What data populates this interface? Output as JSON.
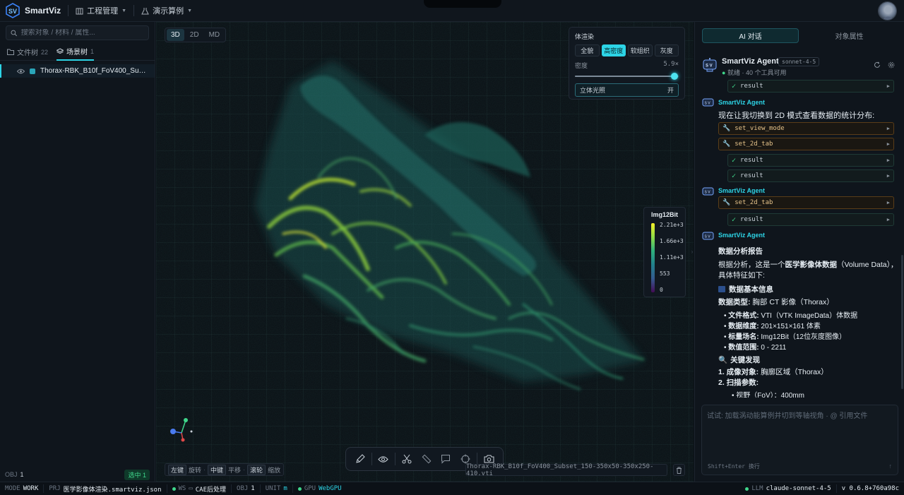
{
  "app": {
    "name": "SmartViz"
  },
  "topbar": {
    "menu_project": "工程管理",
    "menu_examples": "演示算例"
  },
  "left": {
    "search_placeholder": "搜索对象 / 材料 / 属性...",
    "tabs": [
      {
        "label": "文件树",
        "count": "22"
      },
      {
        "label": "场景树",
        "count": "1"
      }
    ],
    "tree_item": "Thorax-RBK_B10f_FoV400_Subs...",
    "footer_obj_label": "OBJ",
    "footer_obj_value": "1",
    "footer_selected": "选中 1"
  },
  "viewport": {
    "view_modes": [
      "3D",
      "2D",
      "MD"
    ],
    "active_view_mode": "3D",
    "volume_panel": {
      "title": "体渲染",
      "presets": [
        "全貌",
        "高密度",
        "软组织",
        "灰度"
      ],
      "active_preset": "高密度",
      "density_label": "密度",
      "density_value": "5.9×",
      "density_fraction": 0.96,
      "lighting_label": "立体光照",
      "lighting_state": "开"
    },
    "colorbar": {
      "title": "Img12Bit",
      "ticks": [
        "2.21e+3",
        "1.66e+3",
        "1.11e+3",
        "553",
        "0"
      ]
    },
    "hints": [
      {
        "key": "左键",
        "action": "旋转"
      },
      {
        "key": "中键",
        "action": "平移"
      },
      {
        "key": "滚轮",
        "action": "缩放"
      }
    ],
    "file_label": "Thorax-RBK_B10f_FoV400_Subset_150-350x50-350x250-410.vti"
  },
  "right": {
    "tabs": [
      "AI 对话",
      "对象属性"
    ],
    "active_tab": "AI 对话",
    "agent": {
      "name": "SmartViz Agent",
      "model": "sonnet-4-5",
      "status_ready": "就绪",
      "status_tools": "· 40 个工具可用"
    },
    "chat": {
      "agent_label": "SmartViz Agent",
      "result_label": "result",
      "msg_switch": "现在让我切换到 2D 模式查看数据的统计分布:",
      "tool_view_mode": "set_view_mode",
      "tool_2d_tab": "set_2d_tab",
      "report_title": "数据分析报告",
      "report_line1_a": "根据分析，这是一个",
      "report_line1_b": "医学影像体数据",
      "report_line1_c": "（Volume Data），",
      "report_line2": "具体特征如下:",
      "section_basic": "数据基本信息",
      "data_type_label": "数据类型:",
      "data_type_value": "胸部 CT 影像（Thorax）",
      "bullets": [
        {
          "label": "文件格式:",
          "value": "VTI（VTK ImageData）体数据"
        },
        {
          "label": "数据维度:",
          "value": "201×151×161 体素"
        },
        {
          "label": "标量场名:",
          "value": "Img12Bit（12位灰度图像）"
        },
        {
          "label": "数值范围:",
          "value": "0 - 2211"
        }
      ],
      "section_findings": "关键发现",
      "finding1_label": "1. 成像对象:",
      "finding1_value": "胸廓区域（Thorax）",
      "finding2_label": "2. 扫描参数:",
      "finding2_sub": "视野（FoV）：400mm"
    },
    "input": {
      "placeholder": "试试: 加载涡动能算例并切到等轴视角 · @ 引用文件",
      "hint": "Shift+Enter 换行"
    }
  },
  "statusbar": {
    "mode_label": "MODE",
    "mode_value": "WORK",
    "prj_label": "PRJ",
    "prj_value": "医学影像体渲染.smartviz.json",
    "ws_label": "WS",
    "ws_value": "CAE后处理",
    "obj_label": "OBJ",
    "obj_value": "1",
    "unit_label": "UNIT",
    "unit_value": "m",
    "gpu_label": "GPU",
    "gpu_value": "WebGPU",
    "llm_label": "LLM",
    "llm_value": "claude-sonnet-4-5",
    "version": "v 0.6.8+760a98c"
  },
  "colors": {
    "accent": "#2dd4e6",
    "ok": "#3fd68b",
    "tool_border": "#5a3d18"
  }
}
